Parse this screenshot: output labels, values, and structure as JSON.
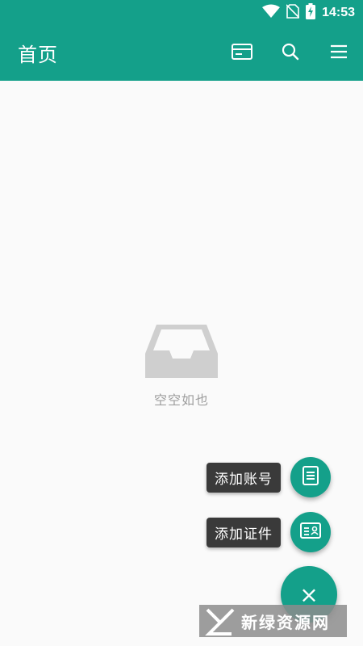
{
  "status_bar": {
    "time": "14:53",
    "icons": [
      "wifi-icon",
      "no-sim-icon",
      "battery-charging-icon"
    ]
  },
  "app_bar": {
    "title": "首页",
    "actions": [
      "card-icon",
      "search-icon",
      "menu-icon"
    ]
  },
  "empty_state": {
    "icon": "empty-inbox-icon",
    "text": "空空如也"
  },
  "fab_menu": {
    "add_account_label": "添加账号",
    "add_certificate_label": "添加证件",
    "close_glyph": "×"
  },
  "watermark": {
    "text": "新绿资源网"
  },
  "colors": {
    "primary": "#14a08a",
    "background": "#fafafa",
    "label_bg": "#3a3a3a",
    "empty_text": "#9e9e9e"
  }
}
